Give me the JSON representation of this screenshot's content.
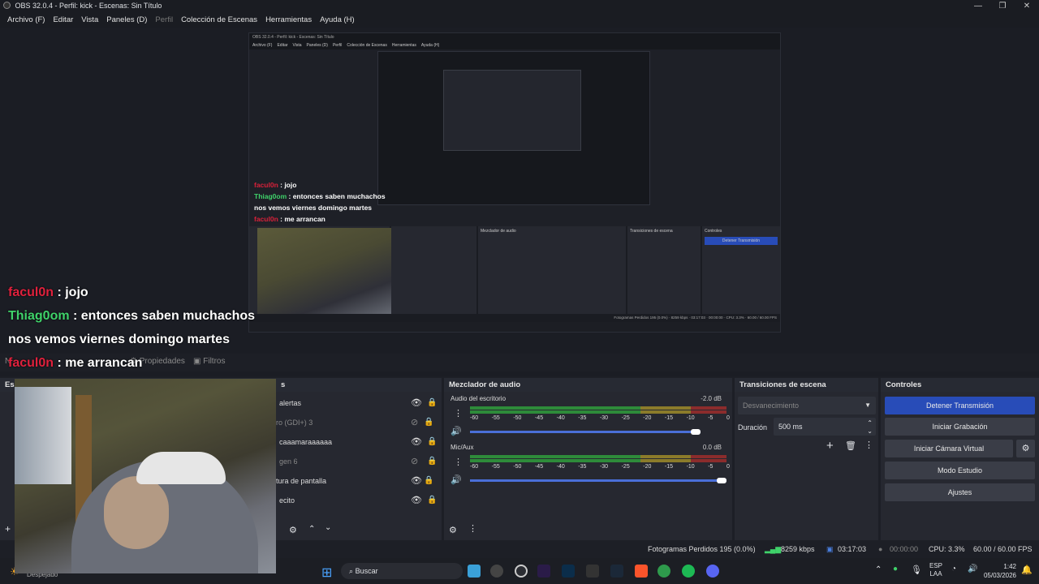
{
  "window": {
    "title": "OBS 32.0.4 - Perfil: kick - Escenas: Sin Título",
    "controls": [
      "—",
      "❐",
      "✕"
    ]
  },
  "menu": [
    "Archivo (F)",
    "Editar",
    "Vista",
    "Paneles (D)",
    "Perfil",
    "Colección de Escenas",
    "Herramientas",
    "Ayuda (H)"
  ],
  "chat": {
    "lines": [
      {
        "user": "facul0n",
        "text": " : jojo"
      },
      {
        "user": "Thiag0om",
        "text": " : entonces saben muchachos"
      },
      {
        "user": "",
        "text": "nos vemos viernes domingo martes"
      },
      {
        "user": "facul0n",
        "text": " : me arrancan"
      }
    ]
  },
  "sources_toolbar": {
    "propiedades": "Propiedades",
    "filtros": "Filtros",
    "n": "N"
  },
  "docks": {
    "escenas": "Esc",
    "fuentes": "s",
    "mixer": "Mezclador de audio",
    "transiciones": "Transiciones de escena",
    "controles": "Controles"
  },
  "sources": [
    {
      "name": "alertas",
      "visible": true
    },
    {
      "name": "ro (GDI+) 3",
      "visible": false
    },
    {
      "name": "caaamaraaaaaa",
      "visible": true
    },
    {
      "name": "gen 6",
      "visible": false
    },
    {
      "name": "tura de pantalla",
      "visible": true
    },
    {
      "name": "ecito",
      "visible": true
    }
  ],
  "mixer": {
    "channels": [
      {
        "name": "Audio del escritorio",
        "db": "-2.0 dB",
        "level": 0.3
      },
      {
        "name": "Mic/Aux",
        "db": "0.0 dB",
        "level": 0.35
      }
    ],
    "scale": [
      "-60",
      "-55",
      "-50",
      "-45",
      "-40",
      "-35",
      "-30",
      "-25",
      "-20",
      "-15",
      "-10",
      "-5",
      "0"
    ]
  },
  "transitions": {
    "selected": "Desvanecimiento",
    "duration_label": "Duración",
    "duration_value": "500 ms"
  },
  "controls": {
    "stop_stream": "Detener Transmisión",
    "start_recording": "Iniciar Grabación",
    "virtual_cam": "Iniciar Cámara Virtual",
    "studio_mode": "Modo Estudio",
    "settings": "Ajustes"
  },
  "statusbar": {
    "dropped": "Fotogramas Perdidos 195 (0.0%)",
    "bitrate": "8259 kbps",
    "stream_time": "03:17:03",
    "rec_time": "00:00:00",
    "cpu": "CPU: 3.3%",
    "fps": "60.00 / 60.00 FPS"
  },
  "taskbar": {
    "search": "Buscar",
    "weather": "Despejado",
    "lang1": "ESP",
    "lang2": "LAA",
    "time": "1:42",
    "date": "05/03/2026"
  },
  "colors": {
    "accent": "#284cb8",
    "user1": "#e0213d",
    "user2": "#3fd26a"
  }
}
